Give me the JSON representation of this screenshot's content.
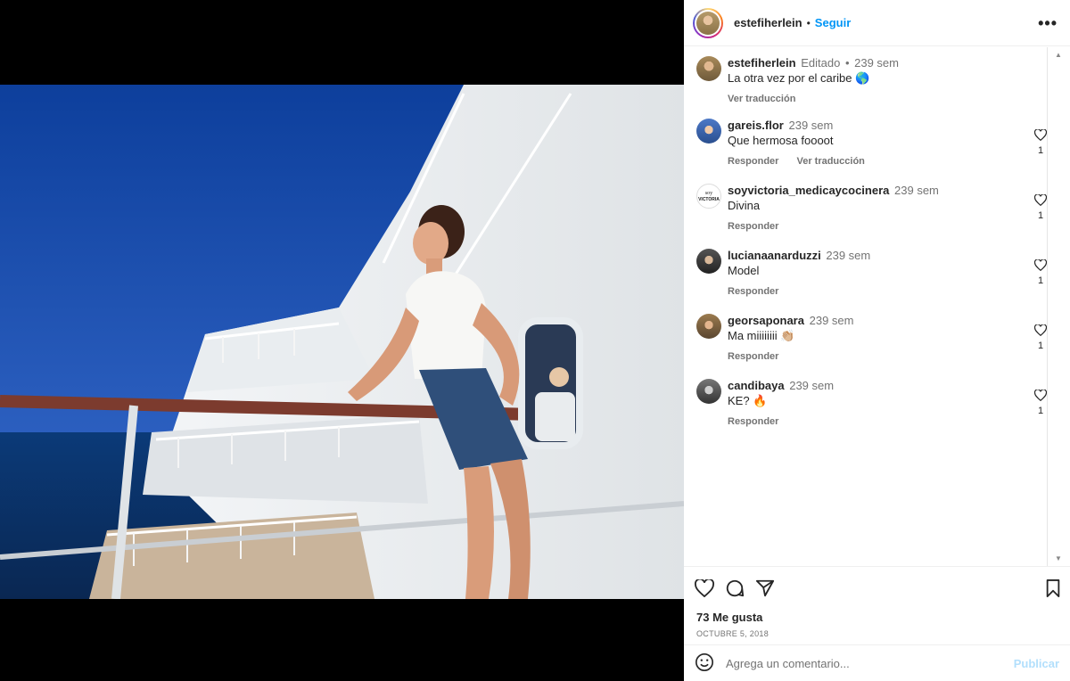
{
  "header": {
    "username": "estefiherlein",
    "separator": "•",
    "follow_label": "Seguir",
    "more_icon": "more-options-icon"
  },
  "caption": {
    "username": "estefiherlein",
    "edited_label": "Editado",
    "separator": "•",
    "time": "239 sem",
    "text": "La otra vez por el caribe 🌎",
    "translate_label": "Ver traducción"
  },
  "comments": [
    {
      "username": "gareis.flor",
      "time": "239 sem",
      "text": "Que hermosa foooot",
      "reply_label": "Responder",
      "translate_label": "Ver traducción",
      "likes": "1"
    },
    {
      "username": "soyvictoria_medicaycocinera",
      "time": "239 sem",
      "text": "Divina",
      "reply_label": "Responder",
      "translate_label": "",
      "likes": "1"
    },
    {
      "username": "lucianaanarduzzi",
      "time": "239 sem",
      "text": "Model",
      "reply_label": "Responder",
      "translate_label": "",
      "likes": "1"
    },
    {
      "username": "georsaponara",
      "time": "239 sem",
      "text": "Ma miiiiiiii 👏🏼",
      "reply_label": "Responder",
      "translate_label": "",
      "likes": "1"
    },
    {
      "username": "candibaya",
      "time": "239 sem",
      "text": "KE? 🔥",
      "reply_label": "Responder",
      "translate_label": "",
      "likes": "1"
    }
  ],
  "post": {
    "likes": "73 Me gusta",
    "date": "Octubre 5, 2018"
  },
  "add_comment": {
    "placeholder": "Agrega un comentario...",
    "publish_label": "Publicar"
  },
  "colors": {
    "accent": "#0095f6",
    "publish_disabled": "#b2dffc",
    "secondary_text": "#737373"
  }
}
